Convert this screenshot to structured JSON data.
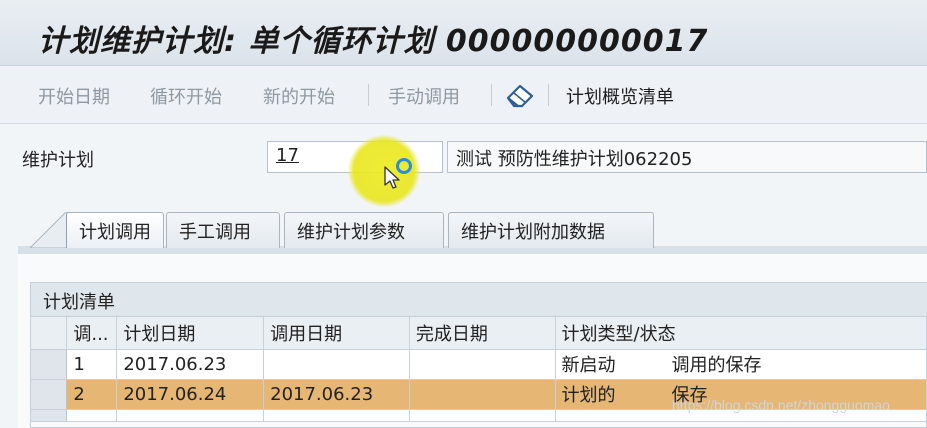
{
  "window": {
    "title": "计划维护计划: 单个循环计划 000000000017"
  },
  "toolbar": {
    "start_date": "开始日期",
    "cycle_start": "循环开始",
    "new_start": "新的开始",
    "manual_call": "手动调用",
    "overview_list": "计划概览清单",
    "icon": "eraser-icon"
  },
  "form": {
    "plan_label": "维护计划",
    "plan_value": "17",
    "plan_description": "测试 预防性维护计划062205"
  },
  "tabs": [
    {
      "label": "计划调用",
      "active": true
    },
    {
      "label": "手工调用",
      "active": false
    },
    {
      "label": "维护计划参数",
      "active": false
    },
    {
      "label": "维护计划附加数据",
      "active": false
    }
  ],
  "schedule": {
    "title": "计划清单",
    "columns": [
      "调...",
      "计划日期",
      "调用日期",
      "完成日期",
      "计划类型/状态"
    ],
    "rows": [
      {
        "call": "1",
        "plan_date": "2017.06.23",
        "call_date": "",
        "done_date": "",
        "type": "新启动",
        "status": "调用的保存"
      },
      {
        "call": "2",
        "plan_date": "2017.06.24",
        "call_date": "2017.06.23",
        "done_date": "",
        "type": "计划的",
        "status": "保存"
      }
    ]
  },
  "watermark": "https://blog.csdn.net/zhongguomao",
  "colors": {
    "highlight_row": "#e6b675",
    "cursor_halo": "#eeec28"
  }
}
